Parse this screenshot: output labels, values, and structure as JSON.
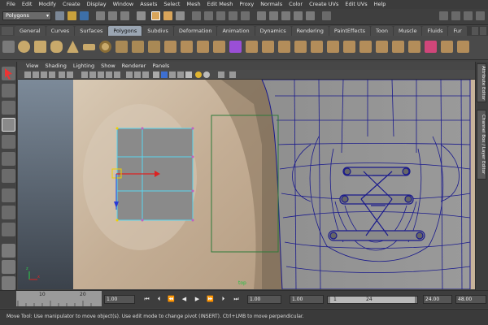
{
  "menubar": {
    "items": [
      "File",
      "Edit",
      "Modify",
      "Create",
      "Display",
      "Window",
      "Assets",
      "Select",
      "Mesh",
      "Edit Mesh",
      "Proxy",
      "Normals",
      "Color",
      "Create UVs",
      "Edit UVs",
      "Help"
    ]
  },
  "statusline": {
    "mode": "Polygons"
  },
  "shelf": {
    "tabs": [
      "General",
      "Curves",
      "Surfaces",
      "Polygons",
      "Subdivs",
      "Deformation",
      "Animation",
      "Dynamics",
      "Rendering",
      "PaintEffects",
      "Toon",
      "Muscle",
      "Fluids",
      "Fur"
    ],
    "active_tab": "Polygons"
  },
  "panel": {
    "menu": [
      "View",
      "Shading",
      "Lighting",
      "Show",
      "Renderer",
      "Panels"
    ],
    "camera_label": "top"
  },
  "side_tabs": {
    "attribute_editor": "Attribute Editor",
    "channel_box": "Channel Box / Layer Editor"
  },
  "timeslider": {
    "tick_10": "10",
    "tick_20": "20",
    "current_time": "1.00",
    "start_time": "1.00",
    "range_start": "1.00",
    "range_handle_start": "1",
    "range_handle_end": "24",
    "range_end": "24.00",
    "end_time": "48.00"
  },
  "helpline": {
    "text": "Move Tool: Use manipulator to move object(s). Use edit mode to change pivot (INSERT).  Ctrl+LMB to move perpendicular."
  },
  "colors": {
    "ui_dark": "#444444",
    "shelf_active": "#9aa5b2",
    "selection_cyan": "#5ad6f0",
    "wire_blue": "#1a1a8c",
    "manip_red": "#d22",
    "manip_yellow": "#f0d000"
  }
}
